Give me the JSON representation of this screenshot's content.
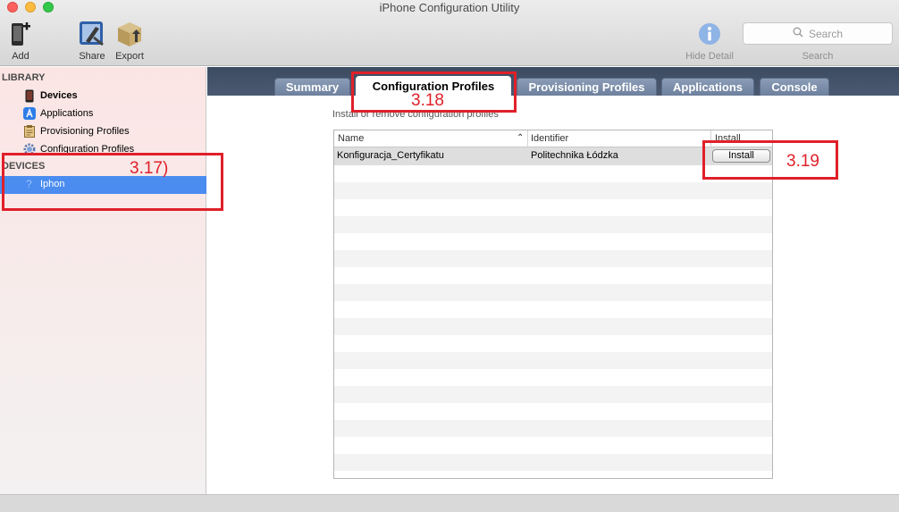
{
  "window": {
    "title": "iPhone Configuration Utility"
  },
  "toolbar": {
    "add_label": "Add",
    "share_label": "Share",
    "export_label": "Export",
    "hide_detail_label": "Hide Detail",
    "search_placeholder": "Search",
    "search_label": "Search"
  },
  "sidebar": {
    "library_header": "LIBRARY",
    "library_items": [
      {
        "label": "Devices",
        "icon": "iphone-icon"
      },
      {
        "label": "Applications",
        "icon": "app-store-icon"
      },
      {
        "label": "Provisioning Profiles",
        "icon": "clipboard-icon"
      },
      {
        "label": "Configuration Profiles",
        "icon": "gear-icon"
      }
    ],
    "devices_header": "DEVICES",
    "devices_items": [
      {
        "label": "Iphon",
        "icon": "question-mark-icon",
        "selected": true
      }
    ]
  },
  "tabs": [
    {
      "label": "Summary"
    },
    {
      "label": "Configuration Profiles",
      "active": true
    },
    {
      "label": "Provisioning Profiles"
    },
    {
      "label": "Applications"
    },
    {
      "label": "Console"
    }
  ],
  "main": {
    "subtitle": "Install or remove configuration profiles",
    "columns": {
      "name": "Name",
      "identifier": "Identifier",
      "install": "Install"
    },
    "rows": [
      {
        "name": "Konfiguracja_Certyfikatu",
        "identifier": "Politechnika Łódzka",
        "button": "Install"
      }
    ]
  },
  "annotations": [
    {
      "label": "3.17)"
    },
    {
      "label": "3.18"
    },
    {
      "label": "3.19"
    }
  ],
  "colors": {
    "annotation_red": "#e0202a",
    "selection_blue": "#4a8cf0",
    "tabbar_navy": "#3c4b60"
  }
}
